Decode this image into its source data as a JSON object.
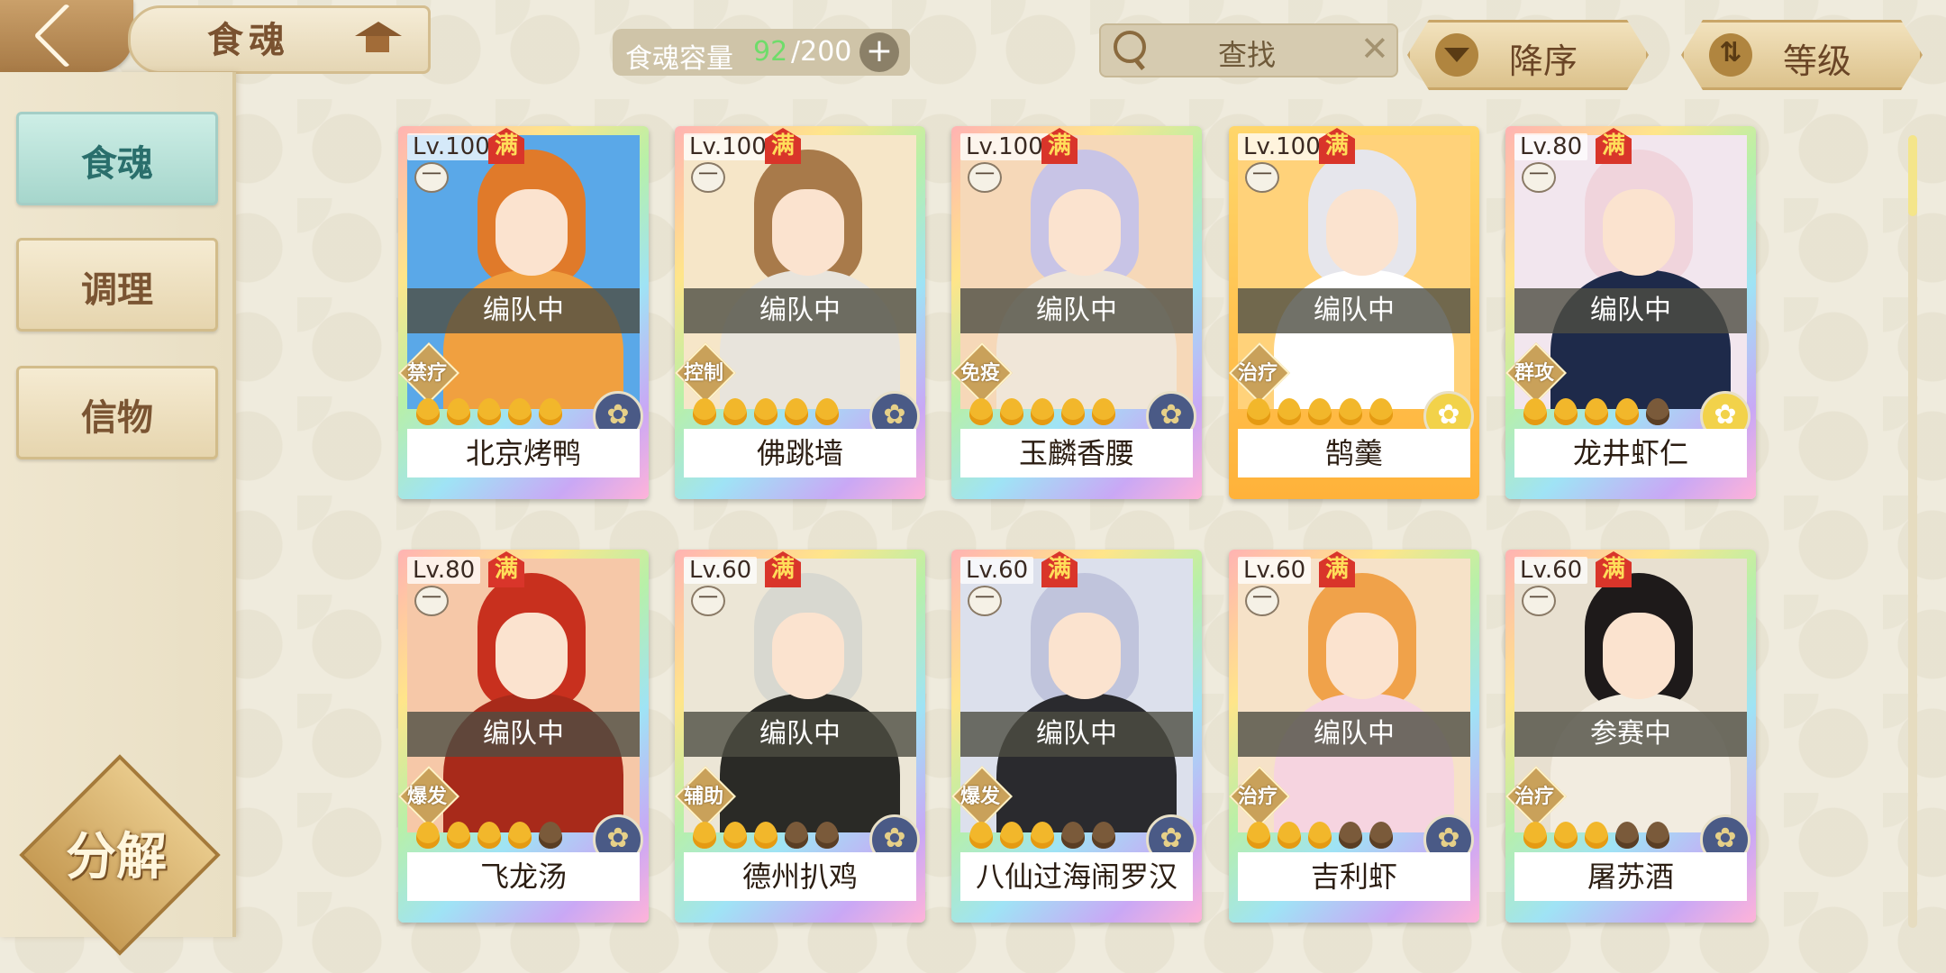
{
  "header": {
    "title": "食魂",
    "capacity_label": "食魂容量",
    "capacity_used": "92",
    "capacity_total": "/200",
    "add_label": "+",
    "search_placeholder": "查找",
    "clear_label": "✕",
    "sort_order_label": "降序",
    "sort_by_label": "等级"
  },
  "sidebar": {
    "items": [
      {
        "label": "食魂"
      },
      {
        "label": "调理"
      },
      {
        "label": "信物"
      }
    ],
    "decompose_label": "分解"
  },
  "cards": [
    {
      "level": "Lv.100",
      "full": "满",
      "rank": "一",
      "status": "编队中",
      "role": "禁疗",
      "stars_on": 5,
      "element": "dark",
      "name": "北京烤鸭",
      "colors": {
        "hair": "#e07a2a",
        "robe": "#f0a040",
        "bg": "#5aa8e8"
      }
    },
    {
      "level": "Lv.100",
      "full": "满",
      "rank": "一",
      "status": "编队中",
      "role": "控制",
      "stars_on": 5,
      "element": "dark",
      "name": "佛跳墙",
      "colors": {
        "hair": "#a87a4a",
        "robe": "#e8e4dc",
        "bg": "#f6e6c8"
      }
    },
    {
      "level": "Lv.100",
      "full": "满",
      "rank": "一",
      "status": "编队中",
      "role": "免疫",
      "stars_on": 5,
      "element": "dark",
      "name": "玉麟香腰",
      "colors": {
        "hair": "#c8c4e6",
        "robe": "#f0e6d8",
        "bg": "#f6d8b8"
      }
    },
    {
      "level": "Lv.100",
      "full": "满",
      "rank": "一",
      "status": "编队中",
      "role": "治疗",
      "stars_on": 5,
      "element": "gold",
      "name": "鹄羹",
      "colors": {
        "hair": "#e6e6ec",
        "robe": "#ffffff",
        "bg": "#ffd27a"
      }
    },
    {
      "level": "Lv.80",
      "full": "满",
      "rank": "一",
      "status": "编队中",
      "role": "群攻",
      "stars_on": 4,
      "element": "gold",
      "name": "龙井虾仁",
      "colors": {
        "hair": "#f0d4dc",
        "robe": "#1e2a4a",
        "bg": "#f2e6ee"
      }
    },
    {
      "level": "Lv.80",
      "full": "满",
      "rank": "一",
      "status": "编队中",
      "role": "爆发",
      "stars_on": 4,
      "element": "dark",
      "name": "飞龙汤",
      "colors": {
        "hair": "#c8301e",
        "robe": "#a82a1a",
        "bg": "#f6c8a8"
      }
    },
    {
      "level": "Lv.60",
      "full": "满",
      "rank": "一",
      "status": "编队中",
      "role": "辅助",
      "stars_on": 3,
      "element": "dark",
      "name": "德州扒鸡",
      "colors": {
        "hair": "#d8d8d0",
        "robe": "#2a2a26",
        "bg": "#ece6d6"
      }
    },
    {
      "level": "Lv.60",
      "full": "满",
      "rank": "一",
      "status": "编队中",
      "role": "爆发",
      "stars_on": 3,
      "element": "dark",
      "name": "八仙过海闹罗汉",
      "colors": {
        "hair": "#c0c4dc",
        "robe": "#2a2a2e",
        "bg": "#dce0ec"
      }
    },
    {
      "level": "Lv.60",
      "full": "满",
      "rank": "一",
      "status": "编队中",
      "role": "治疗",
      "stars_on": 3,
      "element": "dark",
      "name": "吉利虾",
      "colors": {
        "hair": "#f0a24a",
        "robe": "#f6d4e0",
        "bg": "#f6e2c8"
      }
    },
    {
      "level": "Lv.60",
      "full": "满",
      "rank": "一",
      "status": "参赛中",
      "role": "治疗",
      "stars_on": 3,
      "element": "dark",
      "name": "屠苏酒",
      "colors": {
        "hair": "#1e1a1a",
        "robe": "#f2ece0",
        "bg": "#e8e0d0"
      }
    }
  ]
}
